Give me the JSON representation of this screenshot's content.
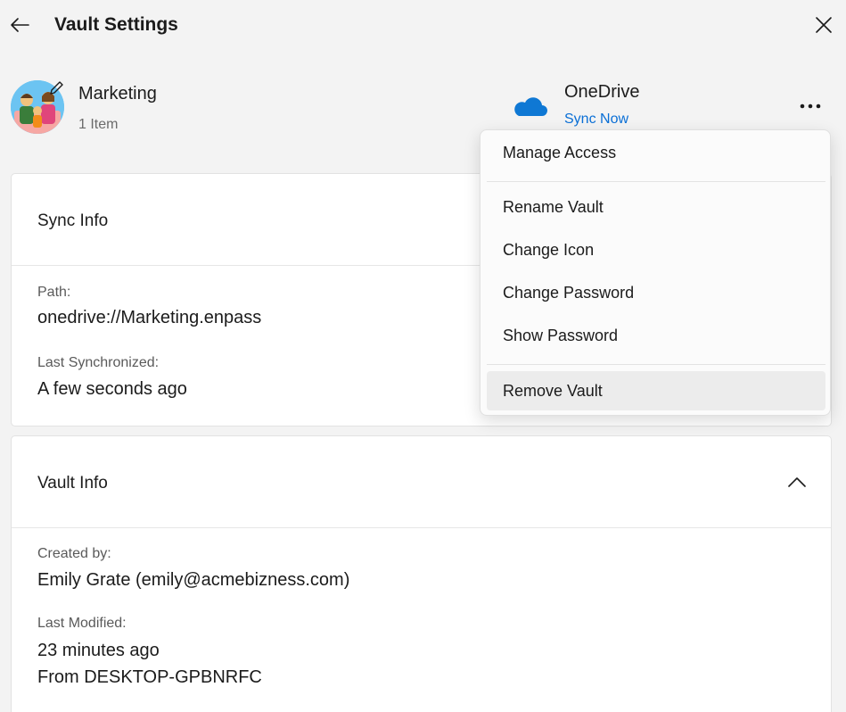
{
  "header": {
    "title": "Vault Settings"
  },
  "vault": {
    "name": "Marketing",
    "item_count": "1 Item",
    "provider": "OneDrive",
    "sync_action": "Sync Now"
  },
  "sync_info": {
    "title": "Sync Info",
    "path_label": "Path:",
    "path_value": "onedrive://Marketing.enpass",
    "last_sync_label": "Last Synchronized:",
    "last_sync_value": "A few seconds ago"
  },
  "vault_info": {
    "title": "Vault Info",
    "created_by_label": "Created by:",
    "created_by_value": "Emily Grate (emily@acmebizness.com)",
    "last_modified_label": "Last Modified:",
    "last_modified_value": "23 minutes ago",
    "last_modified_source": "From DESKTOP-GPBNRFC"
  },
  "menu": {
    "items": [
      {
        "label": "Manage Access"
      },
      {
        "label": "Rename Vault"
      },
      {
        "label": "Change Icon"
      },
      {
        "label": "Change Password"
      },
      {
        "label": "Show Password"
      },
      {
        "label": "Remove Vault"
      }
    ]
  },
  "colors": {
    "link": "#0a6fd6",
    "onedrive_blue": "#0f78d4",
    "background": "#f3f3f3"
  }
}
